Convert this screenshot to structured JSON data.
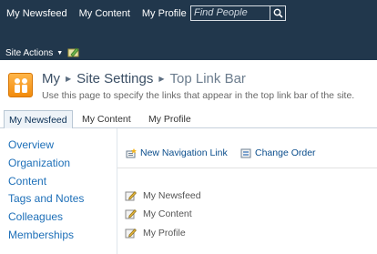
{
  "top_nav": {
    "items": [
      "My Newsfeed",
      "My Content",
      "My Profile"
    ],
    "search_placeholder": "Find People"
  },
  "site_actions": {
    "label": "Site Actions"
  },
  "title_area": {
    "breadcrumb": [
      "My",
      "Site Settings",
      "Top Link Bar"
    ],
    "description": "Use this page to specify the links that appear in the top link bar of the site."
  },
  "tabs": {
    "items": [
      "My Newsfeed",
      "My Content",
      "My Profile"
    ],
    "selected": "My Newsfeed"
  },
  "left_nav": {
    "items": [
      "Overview",
      "Organization",
      "Content",
      "Tags and Notes",
      "Colleagues",
      "Memberships"
    ]
  },
  "toolbar": {
    "new_link": "New Navigation Link",
    "change_order": "Change Order"
  },
  "links": [
    "My Newsfeed",
    "My Content",
    "My Profile"
  ],
  "colors": {
    "top_bar": "#21374c",
    "link_blue": "#1d6fb8",
    "logo_orange": "#f28b0c"
  },
  "icons": {
    "search": "search-icon",
    "edit_page": "edit-page-icon",
    "page_logo": "people-icon",
    "new_link": "new-link-icon",
    "change_order": "change-order-icon",
    "edit_link": "edit-link-icon"
  }
}
